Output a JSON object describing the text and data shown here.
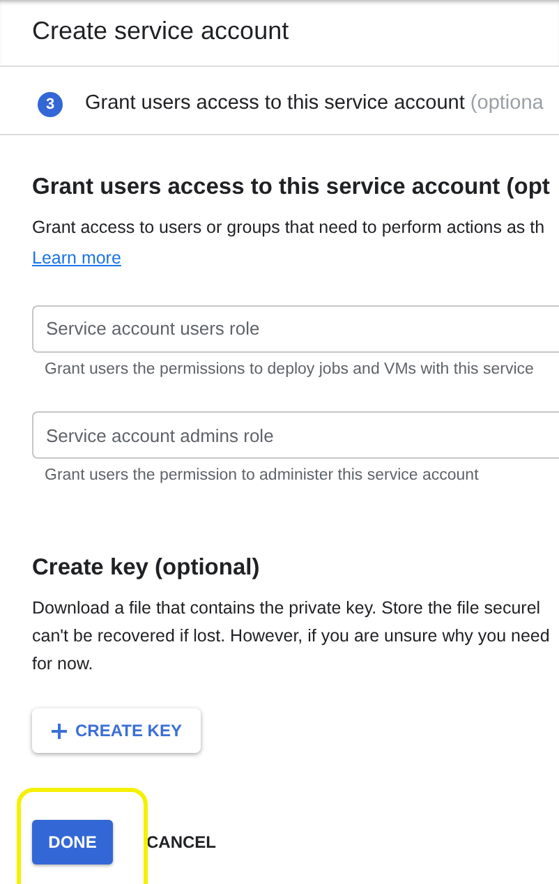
{
  "title": "Create service account",
  "step": {
    "number": "3",
    "label": "Grant users access to this service account",
    "suffix": "(optiona"
  },
  "grant_section": {
    "heading": "Grant users access to this service account (opt",
    "description": "Grant access to users or groups that need to perform actions as th",
    "link": "Learn more",
    "fields": [
      {
        "placeholder": "Service account users role",
        "help": "Grant users the permissions to deploy jobs and VMs with this service"
      },
      {
        "placeholder": "Service account admins role",
        "help": "Grant users the permission to administer this service account"
      }
    ]
  },
  "key_section": {
    "heading": "Create key (optional)",
    "description_lines": [
      "Download a file that contains the private key. Store the file securel",
      "can't be recovered if lost. However, if you are unsure why you need",
      "for now."
    ],
    "button": "CREATE KEY"
  },
  "actions": [
    {
      "label": "DONE",
      "kind": "primary",
      "highlighted": true
    },
    {
      "label": "CANCEL",
      "kind": "text",
      "highlighted": false
    }
  ]
}
